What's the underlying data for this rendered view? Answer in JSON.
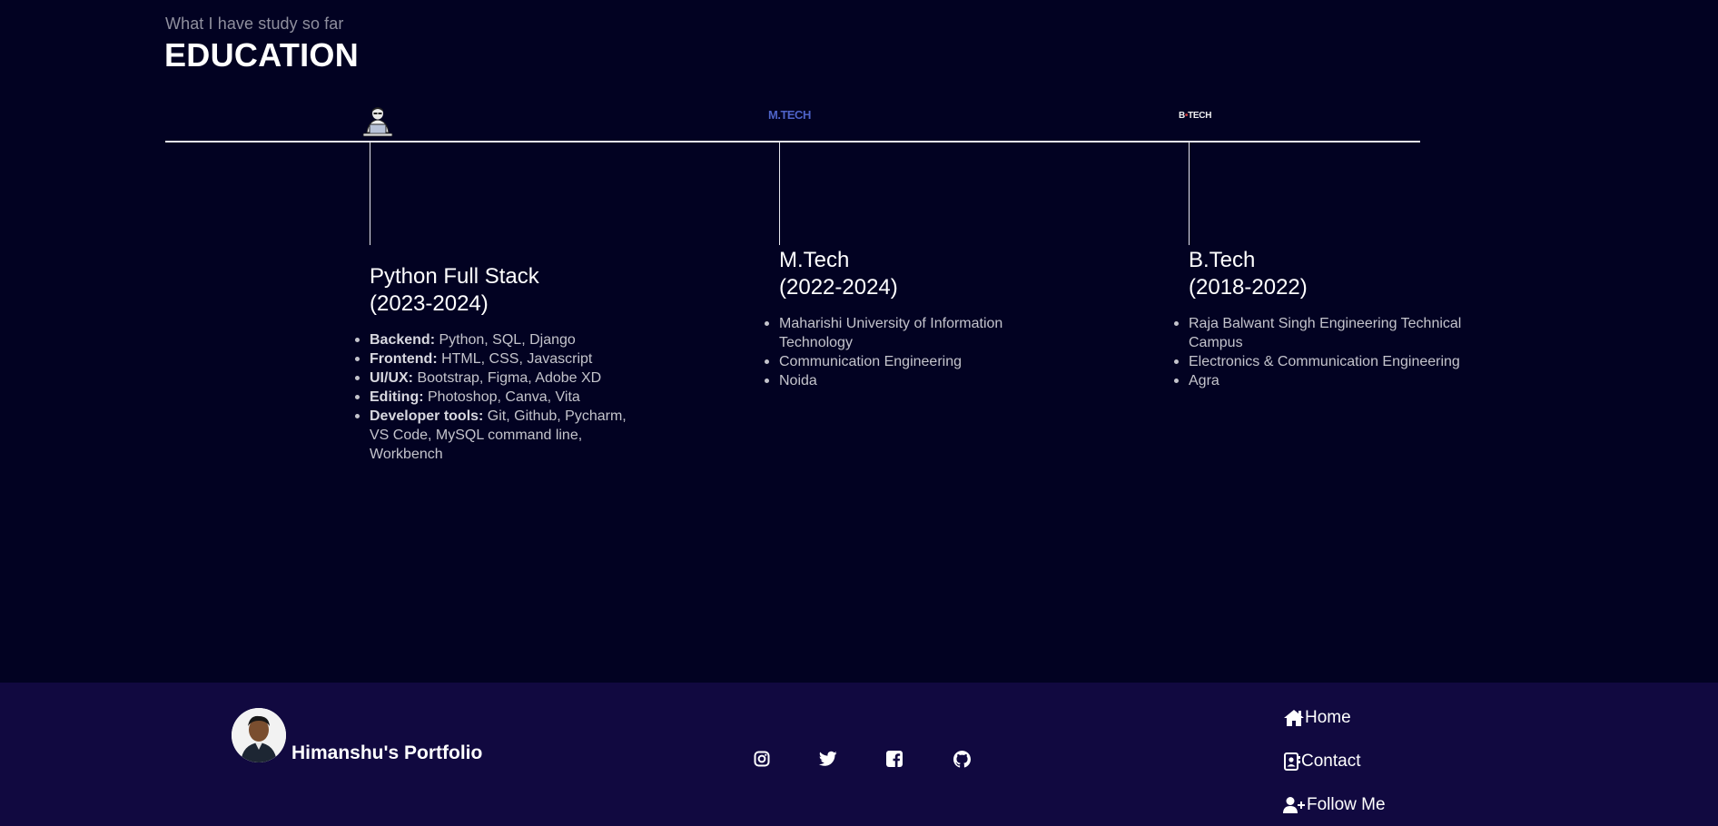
{
  "education": {
    "subtitle": "What I have study so far",
    "title": "EDUCATION",
    "mtech_logo_text": "M.TECH",
    "btech_logo_text_left": "B",
    "btech_logo_text_dot": "•",
    "btech_logo_text_right": "TECH",
    "cards": [
      {
        "title_line1": "Python Full Stack",
        "title_line2": "(2023-2024)",
        "items": [
          {
            "label": "Backend:",
            "text": " Python, SQL, Django"
          },
          {
            "label": "Frontend:",
            "text": " HTML, CSS, Javascript"
          },
          {
            "label": "UI/UX:",
            "text": " Bootstrap, Figma, Adobe XD"
          },
          {
            "label": "Editing:",
            "text": " Photoshop, Canva, Vita"
          },
          {
            "label": "Developer tools:",
            "text": " Git, Github, Pycharm, VS Code, MySQL command line, Workbench"
          }
        ]
      },
      {
        "title_line1": "M.Tech",
        "title_line2": "(2022-2024)",
        "items": [
          "Maharishi University of Information Technology",
          "Communication Engineering",
          "Noida"
        ]
      },
      {
        "title_line1": "B.Tech",
        "title_line2": "(2018-2022)",
        "items": [
          "Raja Balwant Singh Engineering Technical Campus",
          "Electronics & Communication Engineering",
          "Agra"
        ]
      }
    ]
  },
  "footer": {
    "brand": "Himanshu's Portfolio",
    "social_icons": [
      "instagram-icon",
      "twitter-icon",
      "facebook-icon",
      "github-icon"
    ],
    "links": [
      {
        "label": "Home",
        "icon": "home-icon"
      },
      {
        "label": "Contact",
        "icon": "contact-icon"
      },
      {
        "label": "Follow Me",
        "icon": "user-plus-icon"
      }
    ]
  },
  "colors": {
    "background": "#020222",
    "footer_background": "#110940",
    "mtech_logo": "#4e63c8",
    "text_muted": "#c4c4cc"
  }
}
